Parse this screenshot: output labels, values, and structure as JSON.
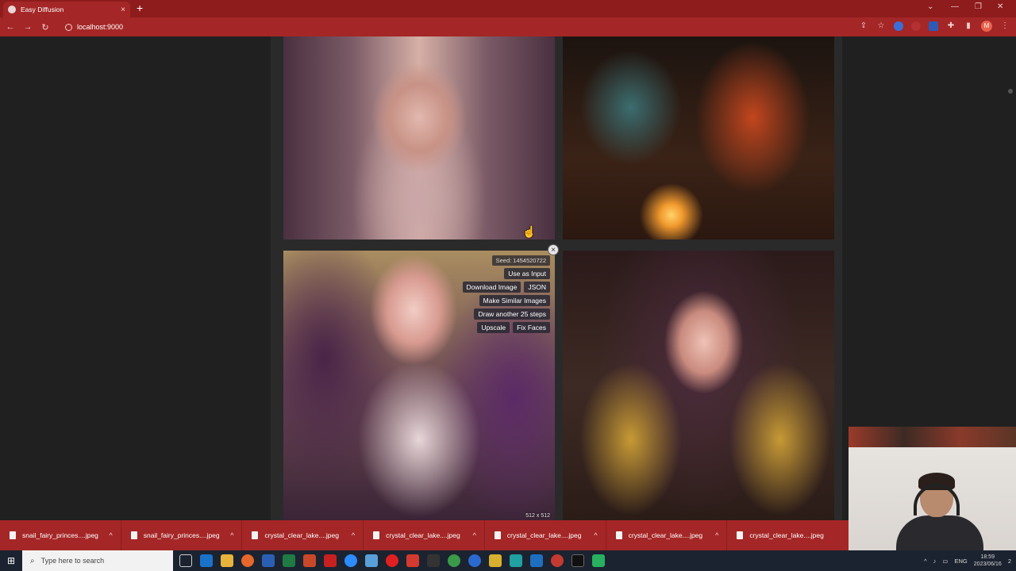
{
  "browser": {
    "tab_title": "Easy Diffusion",
    "tab_close": "×",
    "new_tab": "+",
    "url": "localhost:9000",
    "nav_back": "←",
    "nav_forward": "→",
    "nav_reload": "↻",
    "profile_initial": "M",
    "window_controls": [
      "⌄",
      "—",
      "❐",
      "✕"
    ]
  },
  "gallery": {
    "image_close": "×",
    "overlay": {
      "seed": "Seed: 1454520722",
      "use_as_input": "Use as Input",
      "download_image": "Download Image",
      "json": "JSON",
      "make_similar": "Make Similar Images",
      "draw_another": "Draw another 25 steps",
      "upscale": "Upscale",
      "fix_faces": "Fix Faces"
    },
    "dimensions": "512 x 512"
  },
  "downloads": [
    {
      "label": "snail_fairy_princes....jpeg"
    },
    {
      "label": "snail_fairy_princes....jpeg"
    },
    {
      "label": "crystal_clear_lake....jpeg"
    },
    {
      "label": "crystal_clear_lake....jpeg"
    },
    {
      "label": "crystal_clear_lake....jpeg"
    },
    {
      "label": "crystal_clear_lake....jpeg"
    },
    {
      "label": "crystal_clear_lake....jpeg"
    }
  ],
  "taskbar": {
    "search_placeholder": "Type here to search",
    "language": "ENG",
    "time": "18:59",
    "date": "2023/06/16",
    "notifications": "2"
  },
  "colors": {
    "chrome_dark": "#8e1c1c",
    "chrome": "#a52626",
    "page_bg": "#202020",
    "taskbar": "#1c2330"
  }
}
